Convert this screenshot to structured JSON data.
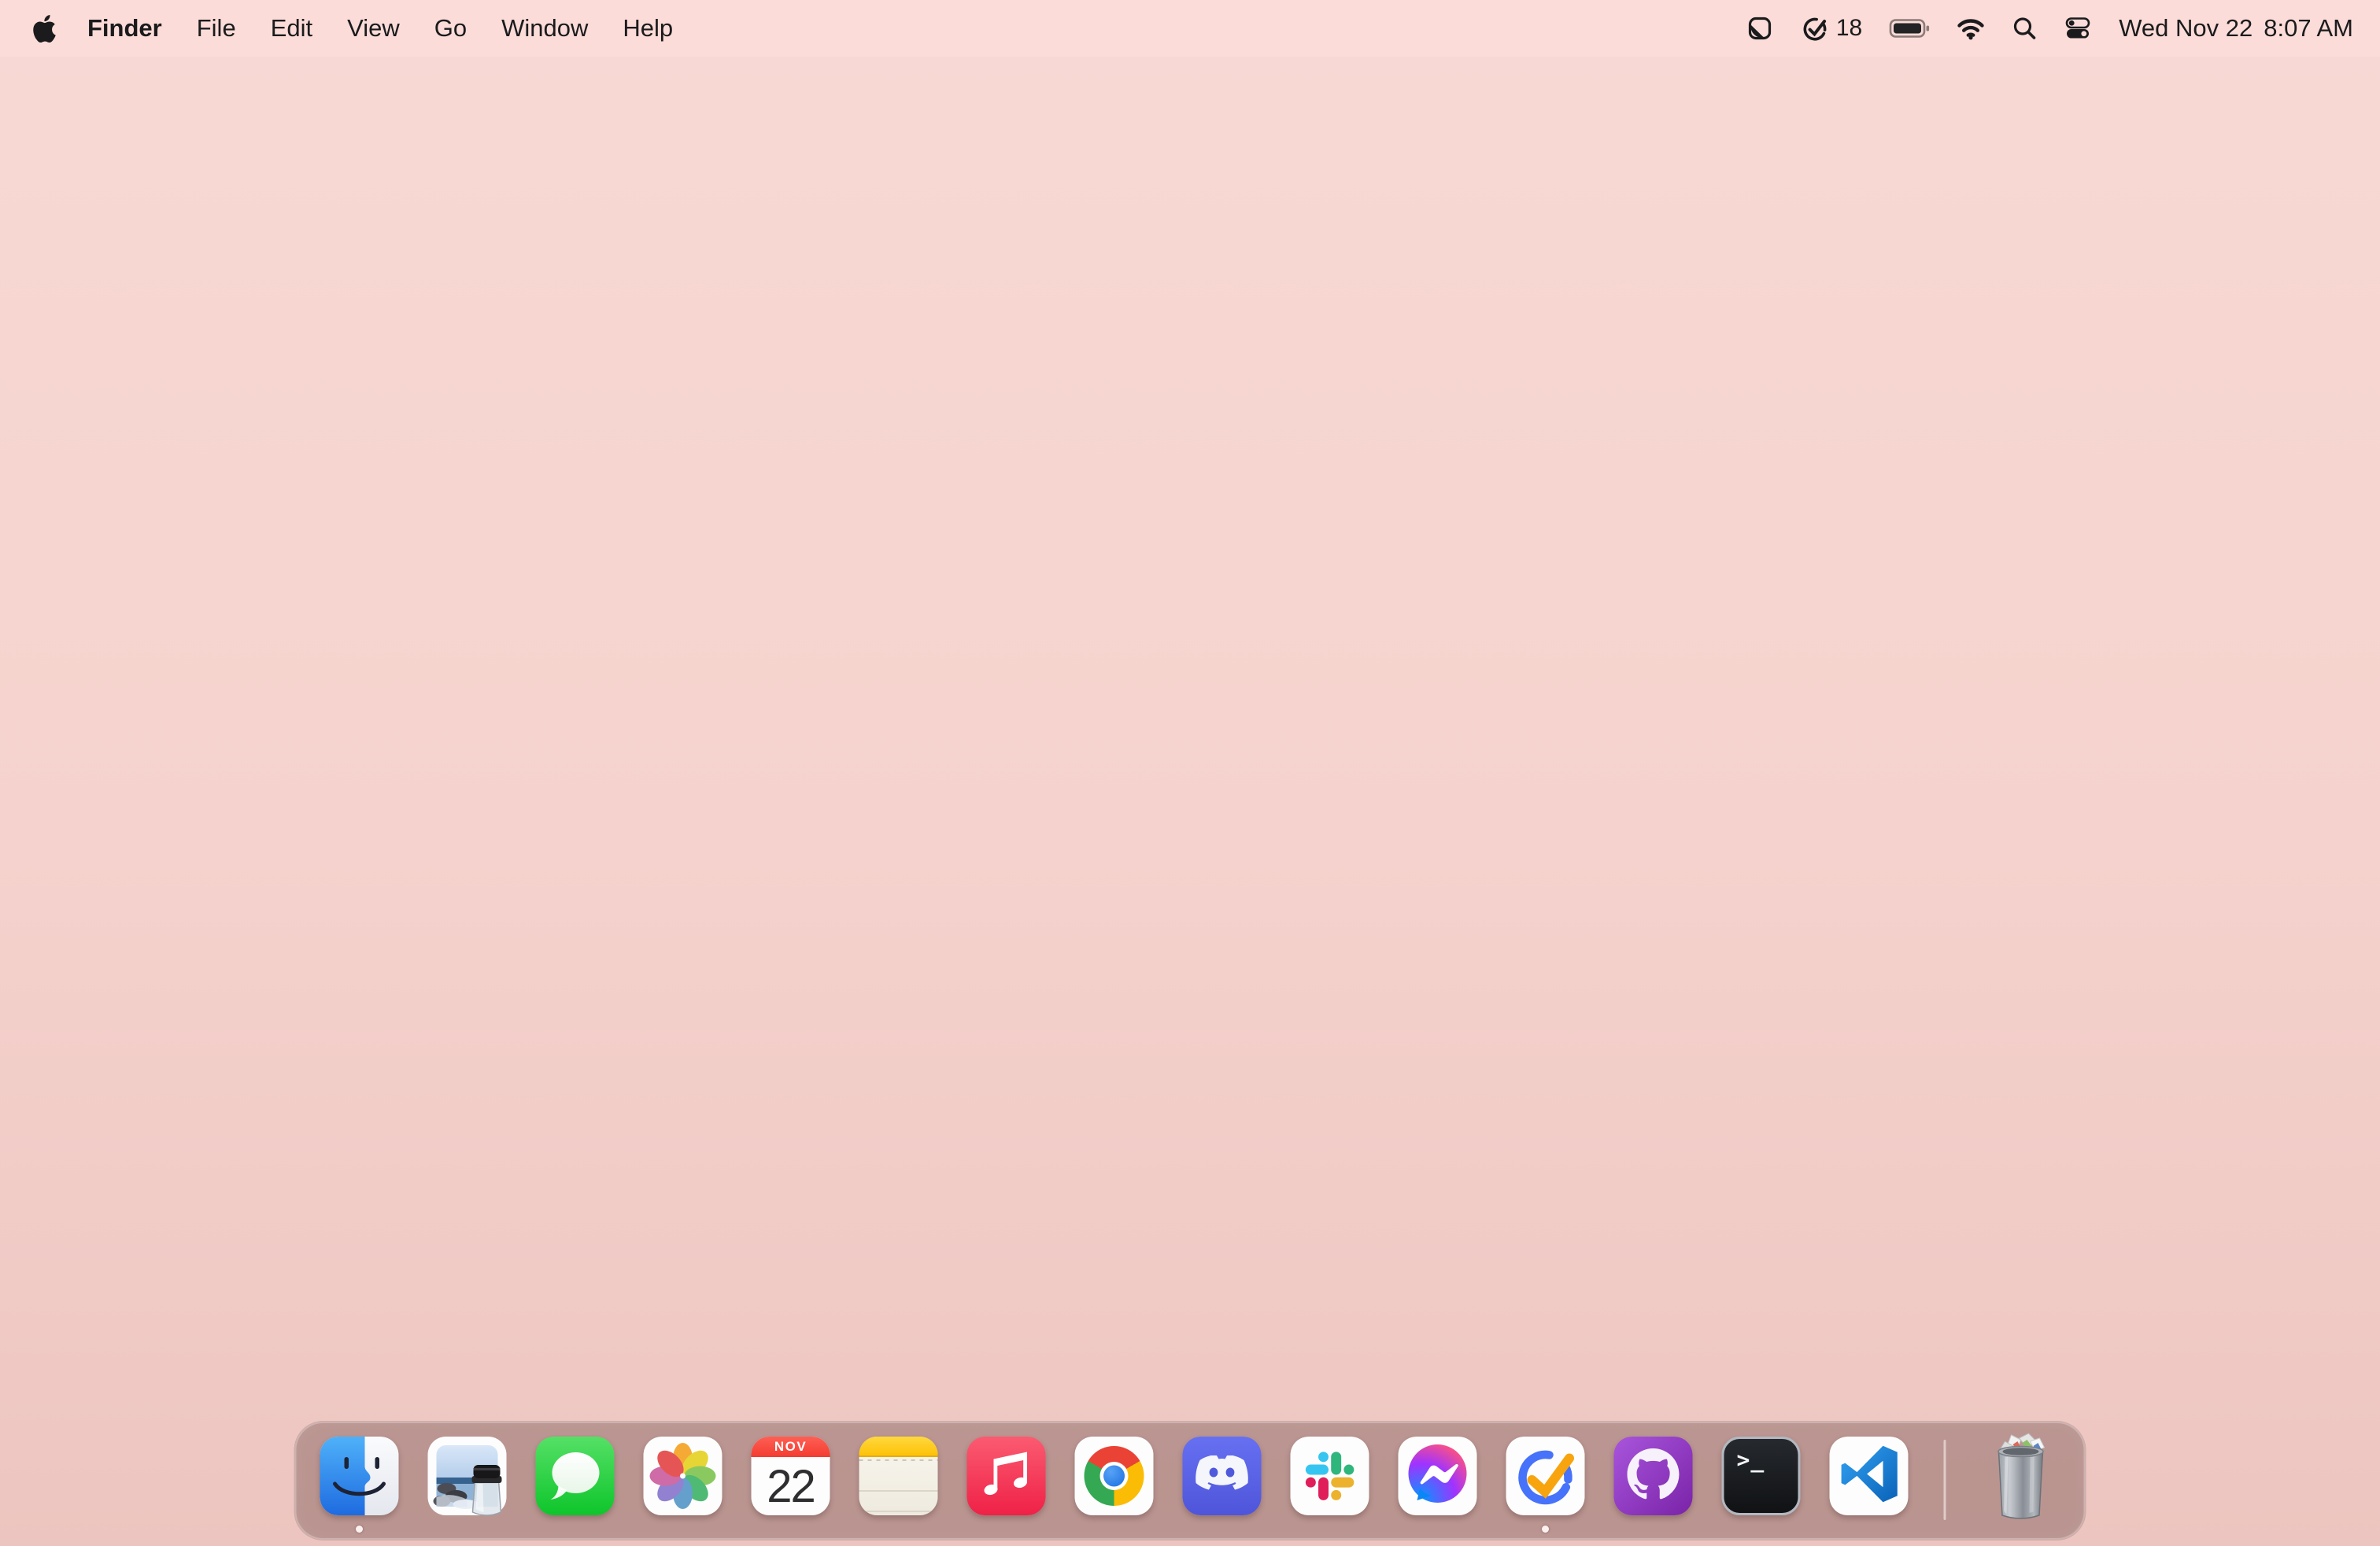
{
  "menubar": {
    "app_menu": "Finder",
    "menus": [
      "File",
      "Edit",
      "View",
      "Go",
      "Window",
      "Help"
    ],
    "status": {
      "sticker_icon": "folded-sticker-icon",
      "tasks_count": "18",
      "battery": "battery-full",
      "wifi": "wifi-on",
      "spotlight": "spotlight-search",
      "control_center": "control-center",
      "date": "Wed Nov 22",
      "time": "8:07 AM"
    }
  },
  "dock": {
    "items": [
      {
        "name": "Finder",
        "running": true
      },
      {
        "name": "Preview",
        "running": false
      },
      {
        "name": "Messages",
        "running": false
      },
      {
        "name": "Photos",
        "running": false
      },
      {
        "name": "Calendar",
        "running": false
      },
      {
        "name": "Notes",
        "running": false
      },
      {
        "name": "Music",
        "running": false
      },
      {
        "name": "Google Chrome",
        "running": false
      },
      {
        "name": "Discord",
        "running": false
      },
      {
        "name": "Slack",
        "running": false
      },
      {
        "name": "Messenger",
        "running": false
      },
      {
        "name": "TickTick",
        "running": true
      },
      {
        "name": "GitHub Desktop",
        "running": false
      },
      {
        "name": "Terminal",
        "running": false
      },
      {
        "name": "Visual Studio Code",
        "running": false
      }
    ],
    "calendar": {
      "month": "NOV",
      "day": "22"
    },
    "terminal_glyph": ">_",
    "trash": {
      "name": "Trash",
      "state": "full"
    }
  },
  "colors": {
    "desktop_top": "#f8d9d4",
    "desktop_mid": "#f5d2cd",
    "desktop_bottom": "#edc5c0",
    "menubar": "#fbdcd8",
    "dock": "rgba(88,58,55,0.35)",
    "ticktick_blue": "#4772fa",
    "ticktick_orange": "#f8a40e",
    "calendar_red": "#f33c30",
    "notes_yellow": "#fdc208"
  }
}
